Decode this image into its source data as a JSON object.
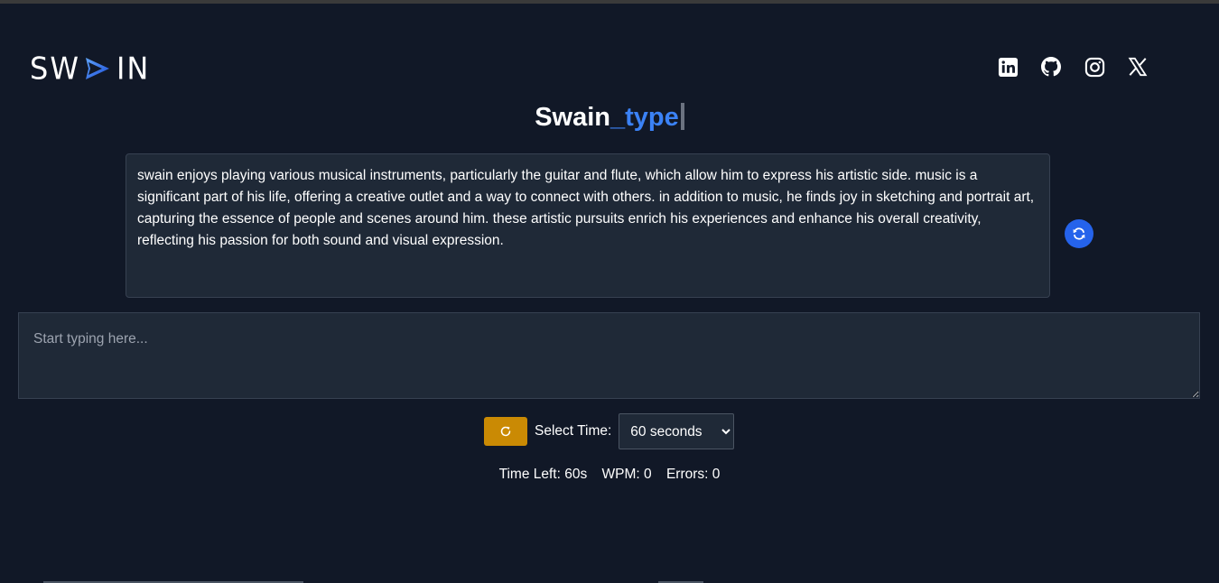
{
  "header": {
    "logo": {
      "left": "SW",
      "right": "IN"
    },
    "social": [
      "linkedin-icon",
      "github-icon",
      "instagram-icon",
      "x-icon"
    ]
  },
  "title": {
    "part1": "Swain",
    "part2": "_type"
  },
  "passage": {
    "text": "swain enjoys playing various musical instruments, particularly the guitar and flute, which allow him to express his artistic side. music is a significant part of his life, offering a creative outlet and a way to connect with others. in addition to music, he finds joy in sketching and portrait art, capturing the essence of people and scenes around him. these artistic pursuits enrich his experiences and enhance his overall creativity, reflecting his passion for both sound and visual expression."
  },
  "typing": {
    "placeholder": "Start typing here...",
    "value": ""
  },
  "controls": {
    "select_label": "Select Time:",
    "time_selected": "60 seconds",
    "time_options": [
      "60 seconds"
    ]
  },
  "stats": {
    "time_left": "Time Left: 60s",
    "wpm": "WPM: 0",
    "errors": "Errors: 0"
  },
  "colors": {
    "background": "#111827",
    "panel": "#1f2937",
    "accent_blue": "#3b82f6",
    "button_blue": "#2563eb",
    "button_amber": "#ca8a04"
  }
}
